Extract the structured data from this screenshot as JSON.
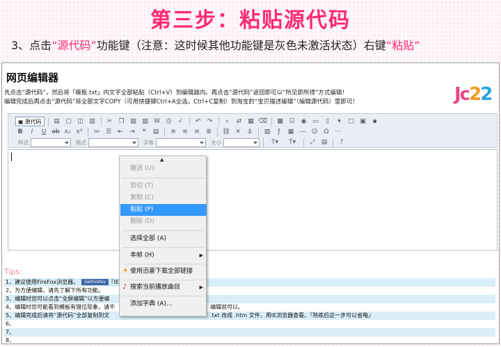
{
  "step": {
    "title": "第三步：粘贴源代码",
    "desc_prefix": "3、点击",
    "desc_highlight1": "“源代码”",
    "desc_middle": "功能键（注意：这时候其他功能键是灰色未激活状态）右键",
    "desc_highlight2": "“粘贴”",
    "accent_color": "#ff2a72"
  },
  "editor": {
    "title": "网页编辑器",
    "instructions": [
      "先点击“源代码”，然后将「模板.txt」内文字全部粘贴（Ctrl+V）到编辑器内。再点击“源代码”返回即可以“所见即所得”方式编辑！",
      "编辑完成后再点击“源代码”将全部文字COPY（可用快捷键Ctrl+A全选，Ctrl+C复制）到淘宝的“宝贝描述编辑”（编辑源代码）里即可！"
    ],
    "logo": {
      "part1": "Jc",
      "part2": "2",
      "part3": "2"
    },
    "toolbar": {
      "source_label": "源代码",
      "style_label": "样式",
      "format_label": "格式",
      "font_label": "字体",
      "size_label": "大小"
    }
  },
  "context_menu": {
    "items": [
      {
        "label": "撤消 (U)",
        "enabled": false
      },
      {
        "label": "剪切 (T)",
        "enabled": false
      },
      {
        "label": "复制 (C)",
        "enabled": false
      },
      {
        "label": "粘贴 (P)",
        "enabled": true,
        "active": true
      },
      {
        "label": "删除 (D)",
        "enabled": false
      },
      {
        "label": "选择全部 (A)",
        "enabled": true
      },
      {
        "label": "本帧 (H)",
        "enabled": true,
        "submenu": true
      },
      {
        "label": "使用迅雷下载全部链接",
        "enabled": true,
        "icon": "thunder-icon"
      },
      {
        "label": "搜索当前播放曲目",
        "enabled": true,
        "submenu": true,
        "icon": "music-icon"
      },
      {
        "label": "添加字典 (A)...",
        "enabled": true
      }
    ]
  },
  "tips": {
    "label": "Tips:",
    "rows": [
      {
        "text": "1、建议使用FireFox浏览器。",
        "badge": "GetFirefox",
        "after": "『IE"
      },
      {
        "text": "2、为方便编辑，请先了解下所有功能。"
      },
      {
        "text": "3、编辑时您可以点击“全屏编辑”以方便编"
      },
      {
        "text": "4、编辑时您可能看到模板有错位现象，请不",
        "tail": "编辑就可以。"
      },
      {
        "text": "5、编辑完成后请将“源代码”全部复制到文",
        "tail": ".txt 改成 .htm 文件，用IE浏览器查看。『熟练后这一步可以省略』"
      },
      {
        "text": "6、"
      },
      {
        "text": "7、"
      },
      {
        "text": "8、"
      }
    ]
  }
}
